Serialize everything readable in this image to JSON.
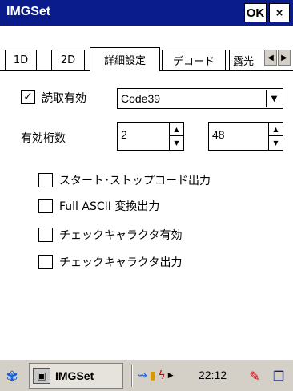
{
  "window": {
    "title": "IMGSet",
    "ok_label": "OK",
    "close_label": "×"
  },
  "tabs": [
    {
      "label": "1D"
    },
    {
      "label": "2D"
    },
    {
      "label": "詳細設定"
    },
    {
      "label": "デコード"
    },
    {
      "label": "露光"
    }
  ],
  "tab_scroll": {
    "left": "◀",
    "right": "▶"
  },
  "read_enable": {
    "label": "読取有効",
    "checked": true,
    "check_glyph": "✓"
  },
  "symbology": {
    "selected": "Code39"
  },
  "digits": {
    "label": "有効桁数",
    "min": "2",
    "max": "48"
  },
  "options": [
    {
      "label": "スタート･ストップコード出力",
      "checked": false
    },
    {
      "label": "Full ASCII 変換出力",
      "checked": false
    },
    {
      "label": "チェックキャラクタ有効",
      "checked": false
    },
    {
      "label": "チェックキャラクタ出力",
      "checked": false
    }
  ],
  "taskbar": {
    "task_label": "IMGSet",
    "time": "22:12"
  },
  "colors": {
    "titlebar": "#0a1b8c",
    "taskbar": "#d4d0c8"
  }
}
